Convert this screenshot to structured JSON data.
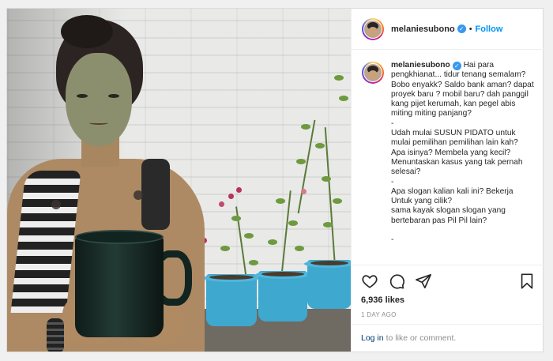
{
  "post": {
    "username": "melaniesubono",
    "verified_icon": "verified-badge-icon",
    "dot": "•",
    "follow_label": "Follow",
    "caption_lines": [
      "Hai para",
      "pengkhianat... tidur tenang semalam?",
      "Bobo enyakk? Saldo bank aman? dapat",
      "proyek baru ? mobil baru? dah panggil",
      "kang pijet kerumah, kan pegel abis",
      "miting miting panjang?",
      "-",
      "Udah mulai SUSUN PIDATO untuk",
      "mulai pemilihan pemilihan lain kah?",
      "Apa isinya? Membela yang kecil?",
      "Menuntaskan kasus yang tak pernah",
      "selesai?",
      "-",
      "Apa slogan kalian kali ini? Bekerja",
      "Untuk yang cilik?",
      "sama kayak slogan slogan yang",
      "bertebaran pas Pil Pil lain?",
      "",
      "-"
    ],
    "likes": "6,936 likes",
    "time_ago": "1 DAY AGO",
    "login_link": "Log in",
    "login_suffix": "to like or comment.",
    "colors": {
      "link_blue": "#0095f6",
      "verified_blue": "#3897f0",
      "pot_blue": "#3ea8cf"
    },
    "icons": [
      "heart-icon",
      "comment-icon",
      "share-icon",
      "bookmark-icon"
    ]
  }
}
